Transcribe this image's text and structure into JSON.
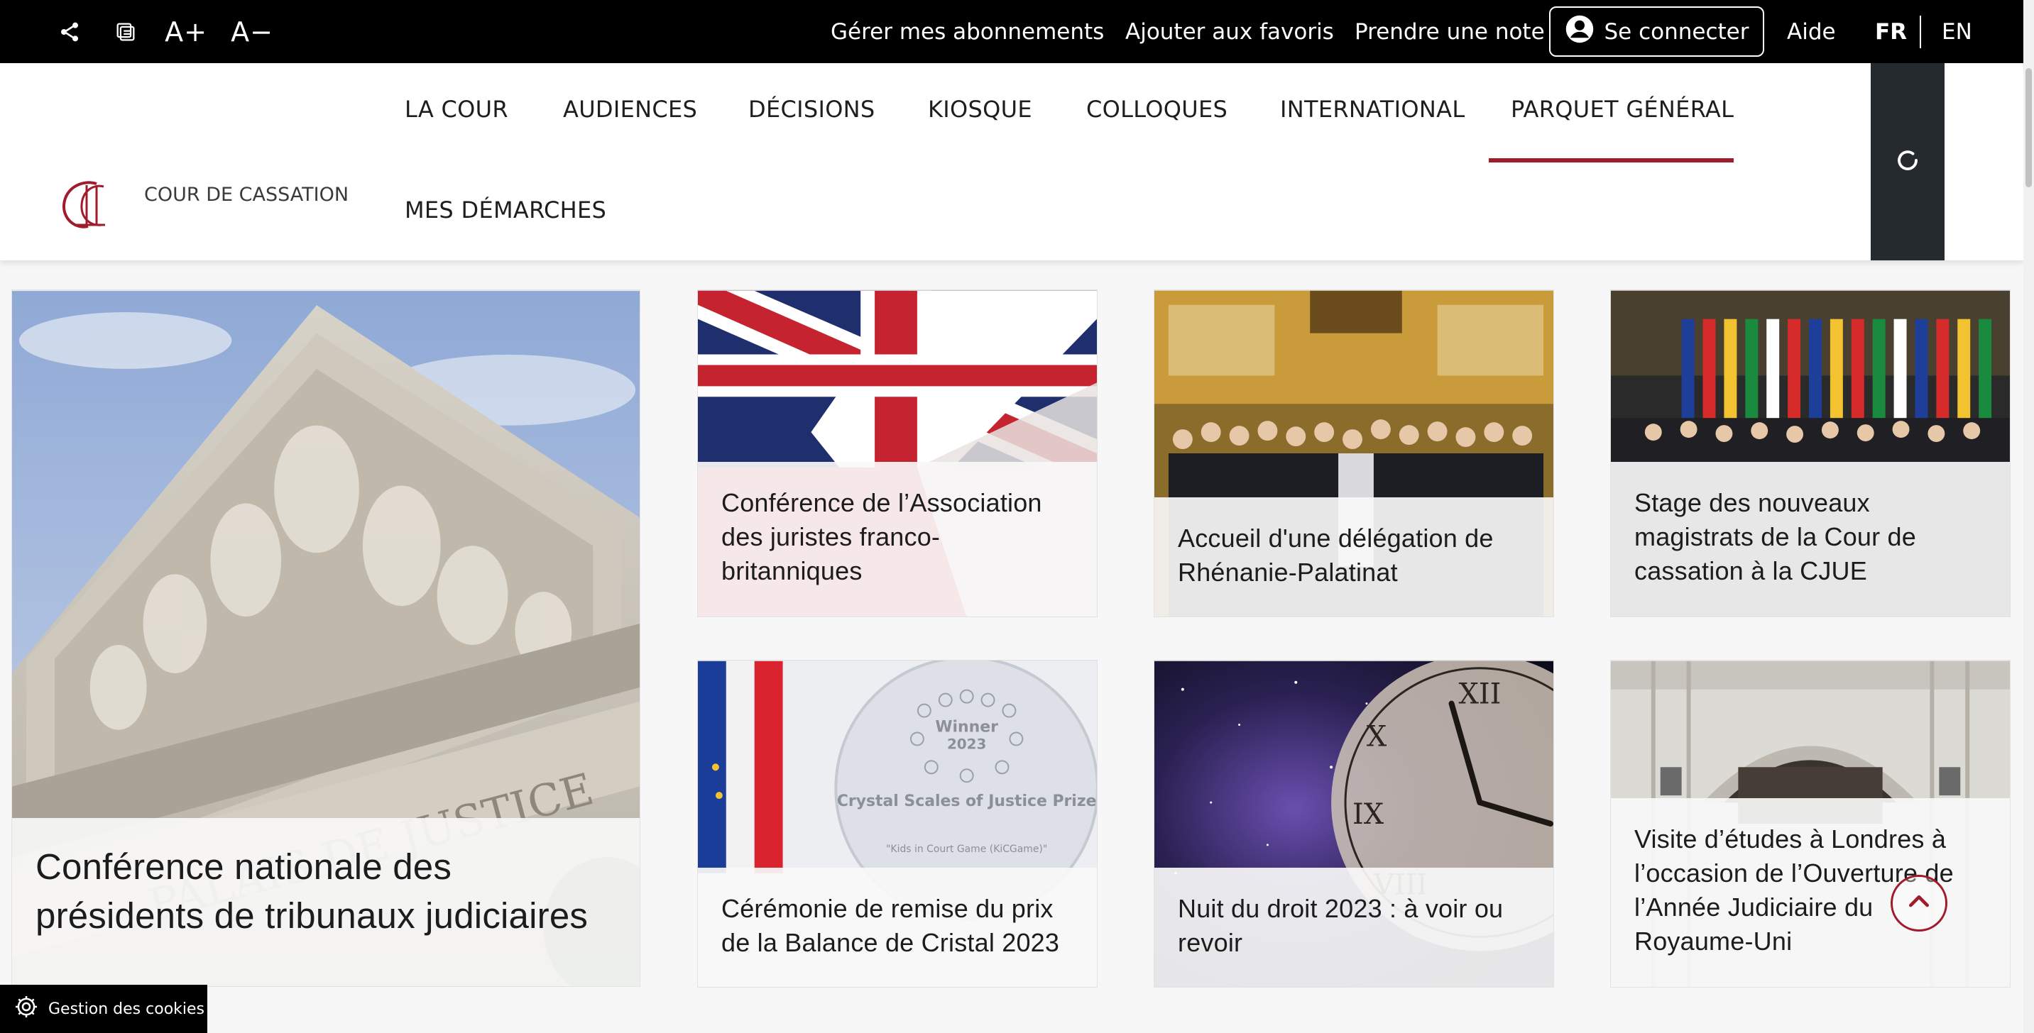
{
  "colors": {
    "accent": "#a01b2c",
    "topbar_bg": "#000000",
    "search_bg": "#252a2e"
  },
  "topbar": {
    "icons": [
      "share-icon",
      "print-icon"
    ],
    "font_increase": "A+",
    "font_decrease": "A−",
    "links": {
      "subscriptions": "Gérer mes abonnements",
      "favorites": "Ajouter aux favoris",
      "note": "Prendre une note"
    },
    "login": "Se connecter",
    "help": "Aide",
    "lang_fr": "FR",
    "lang_en": "EN"
  },
  "header": {
    "logo_text": "COUR DE CASSATION",
    "nav": {
      "la_cour": "LA COUR",
      "audiences": "AUDIENCES",
      "decisions": "DÉCISIONS",
      "kiosque": "KIOSQUE",
      "colloques": "COLLOQUES",
      "international": "INTERNATIONAL",
      "parquet": "PARQUET GÉNÉRAL",
      "demarches": "MES DÉMARCHES"
    },
    "active_nav": "PARQUET GÉNÉRAL"
  },
  "cards": {
    "featured": {
      "title": "Conférence nationale des présidents de tribunaux judiciaires",
      "image": "palais-de-justice-pediment"
    },
    "c1": {
      "title": "Conférence de l’Association des juristes franco-britanniques",
      "image": "union-jack-flag"
    },
    "c2": {
      "title": "Accueil d'une délégation de Rhénanie-Palatinat",
      "image": "group-photo-gilded-room"
    },
    "c3": {
      "title": "Stage des nouveaux magistrats de la Cour de cassation à la CJUE",
      "image": "group-photo-flags"
    },
    "c4": {
      "title": "Cérémonie de remise du prix de la Balance de Cristal 2023",
      "image": "crystal-award-flags",
      "award_text": {
        "winner": "Winner",
        "year": "2023",
        "prize": "Crystal Scales of Justice Prize",
        "subtitle": "\"Kids in Court Game (KiCGame)\""
      }
    },
    "c5": {
      "title": "Nuit du droit 2023 : à voir ou revoir",
      "image": "clock-starry-night"
    },
    "c6": {
      "title": "Visite d’études à Londres à l’occasion de l’Ouverture de l’Année Judiciaire du Royaume-Uni",
      "image": "london-court-building"
    }
  },
  "pediment_text": "PALAIS DE JUSTICE",
  "cookie_label": "Gestion des cookies"
}
